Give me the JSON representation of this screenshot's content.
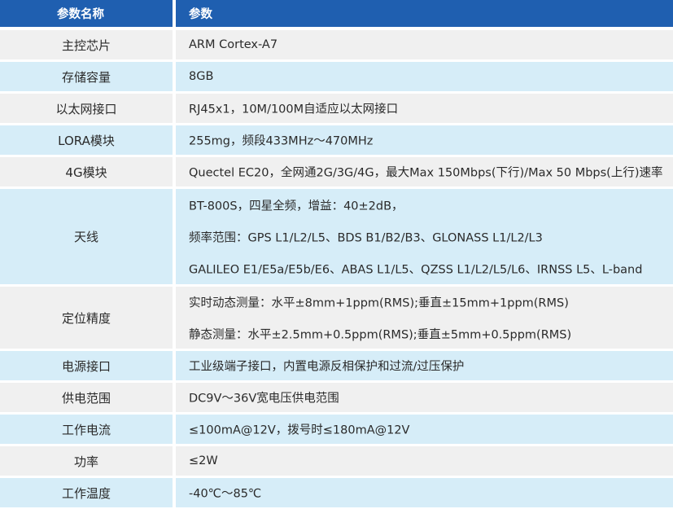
{
  "header": {
    "name": "参数名称",
    "value": "参数"
  },
  "rows": [
    {
      "name": "主控芯片",
      "lines": [
        "ARM Cortex-A7"
      ]
    },
    {
      "name": "存储容量",
      "lines": [
        "8GB"
      ]
    },
    {
      "name": "以太网接口",
      "lines": [
        "RJ45x1，10M/100M自适应以太网接口"
      ]
    },
    {
      "name": "LORA模块",
      "lines": [
        "255mg，频段433MHz～470MHz"
      ]
    },
    {
      "name": "4G模块",
      "lines": [
        "Quectel EC20，全网通2G/3G/4G，最大Max 150Mbps(下行)/Max 50 Mbps(上行)速率"
      ]
    },
    {
      "name": "天线",
      "lines": [
        "BT-800S，四星全频，增益：40±2dB，",
        "频率范围：GPS L1/L2/L5、BDS B1/B2/B3、GLONASS L1/L2/L3",
        "GALILEO E1/E5a/E5b/E6、ABAS L1/L5、QZSS L1/L2/L5/L6、IRNSS L5、L-band"
      ]
    },
    {
      "name": "定位精度",
      "lines": [
        "实时动态测量：水平±8mm+1ppm(RMS);垂直±15mm+1ppm(RMS)",
        "静态测量：水平±2.5mm+0.5ppm(RMS);垂直±5mm+0.5ppm(RMS)"
      ]
    },
    {
      "name": "电源接口",
      "lines": [
        "工业级端子接口，内置电源反相保护和过流/过压保护"
      ]
    },
    {
      "name": "供电范围",
      "lines": [
        "DC9V～36V宽电压供电范围"
      ]
    },
    {
      "name": "工作电流",
      "lines": [
        "≤100mA@12V，拨号时≤180mA@12V"
      ]
    },
    {
      "name": "功率",
      "lines": [
        "≤2W"
      ]
    },
    {
      "name": "工作温度",
      "lines": [
        "-40℃～85℃"
      ]
    }
  ]
}
